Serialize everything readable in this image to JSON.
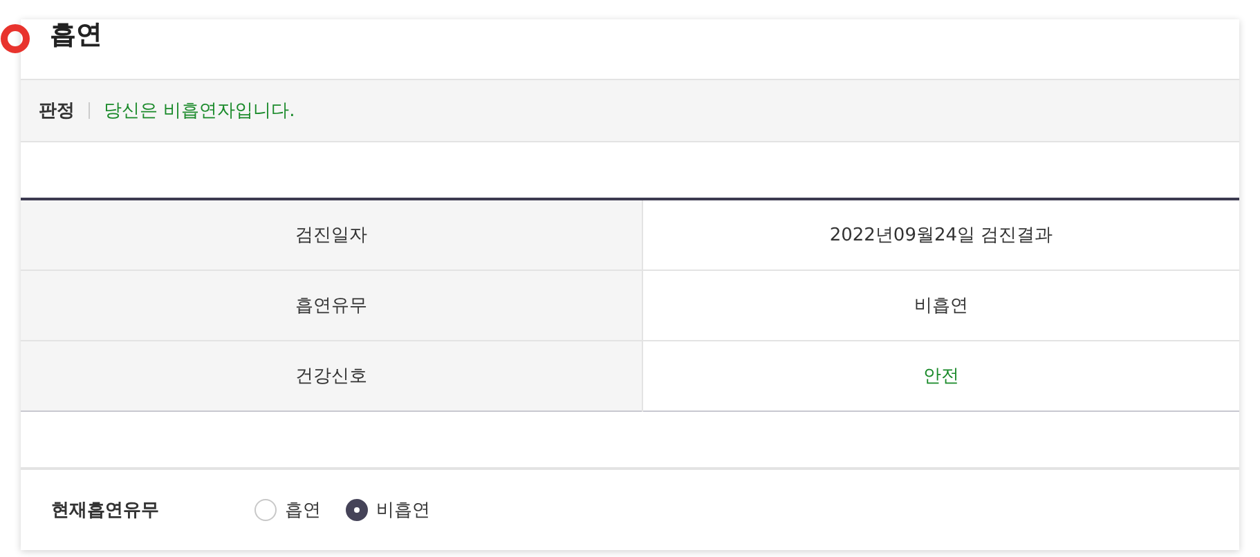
{
  "section": {
    "title": "흡연"
  },
  "verdict": {
    "label": "판정",
    "message": "당신은 비흡연자입니다."
  },
  "table": {
    "rows": [
      {
        "label": "검진일자",
        "value": "2022년09월24일 검진결과",
        "kind": "plain"
      },
      {
        "label": "흡연유무",
        "value": "비흡연",
        "kind": "plain"
      },
      {
        "label": "건강신호",
        "value": "안전",
        "kind": "good"
      }
    ]
  },
  "question": {
    "label": "현재흡연유무",
    "options": [
      {
        "label": "흡연",
        "selected": false
      },
      {
        "label": "비흡연",
        "selected": true
      }
    ]
  }
}
